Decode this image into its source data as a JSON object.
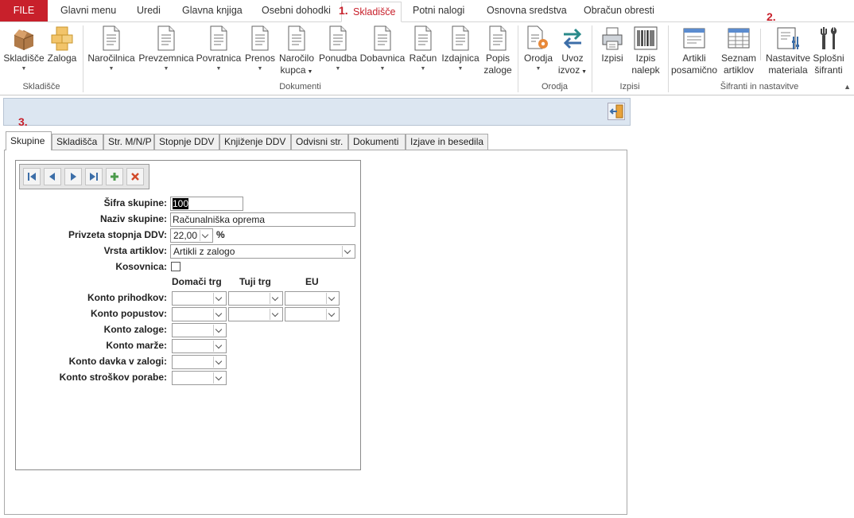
{
  "ribbon_tabs": [
    {
      "label": "FILE"
    },
    {
      "label": "Glavni menu"
    },
    {
      "label": "Uredi"
    },
    {
      "label": "Glavna knjiga"
    },
    {
      "label": "Osebni dohodki"
    },
    {
      "label": "Skladišče"
    },
    {
      "label": "Potni nalogi"
    },
    {
      "label": "Osnovna sredstva"
    },
    {
      "label": "Obračun obresti"
    }
  ],
  "markers": {
    "m1": "1.",
    "m2": "2.",
    "m3": "3."
  },
  "ribbon": {
    "buttons": [
      {
        "line1": "Skladišče",
        "line2": ""
      },
      {
        "line1": "Zaloga",
        "line2": ""
      },
      {
        "line1": "Naročilnica",
        "line2": ""
      },
      {
        "line1": "Prevzemnica",
        "line2": ""
      },
      {
        "line1": "Povratnica",
        "line2": ""
      },
      {
        "line1": "Prenos",
        "line2": ""
      },
      {
        "line1": "Naročilo",
        "line2": "kupca"
      },
      {
        "line1": "Ponudba",
        "line2": ""
      },
      {
        "line1": "Dobavnica",
        "line2": ""
      },
      {
        "line1": "Račun",
        "line2": ""
      },
      {
        "line1": "Izdajnica",
        "line2": ""
      },
      {
        "line1": "Popis",
        "line2": "zaloge"
      },
      {
        "line1": "Orodja",
        "line2": ""
      },
      {
        "line1": "Uvoz",
        "line2": "izvoz"
      },
      {
        "line1": "Izpisi",
        "line2": ""
      },
      {
        "line1": "Izpis",
        "line2": "nalepk"
      },
      {
        "line1": "Artikli",
        "line2": "posamično"
      },
      {
        "line1": "Seznam",
        "line2": "artiklov"
      },
      {
        "line1": "Nastavitve",
        "line2": "materiala"
      },
      {
        "line1": "Splošni",
        "line2": "šifranti"
      }
    ],
    "groups": [
      {
        "label": "Skladišče"
      },
      {
        "label": "Dokumenti"
      },
      {
        "label": "Orodja"
      },
      {
        "label": "Izpisi"
      },
      {
        "label": "Šifranti in nastavitve"
      }
    ]
  },
  "form_tabs": [
    {
      "label": "Skupine"
    },
    {
      "label": "Skladišča"
    },
    {
      "label": "Str. M/N/P"
    },
    {
      "label": "Stopnje DDV"
    },
    {
      "label": "Knjiženje DDV"
    },
    {
      "label": "Odvisni str."
    },
    {
      "label": "Dokumenti"
    },
    {
      "label": "Izjave in besedila"
    }
  ],
  "form": {
    "sifra_label": "Šifra skupine:",
    "sifra_value": "100",
    "naziv_label": "Naziv skupine:",
    "naziv_value": "Računalniška oprema",
    "ddv_label": "Privzeta stopnja DDV:",
    "ddv_value": "22,00",
    "ddv_unit": "%",
    "vrsta_label": "Vrsta artiklov:",
    "vrsta_value": "Artikli z zalogo",
    "kosovnica_label": "Kosovnica:",
    "kosovnica_checked": false,
    "col_domaci": "Domači trg",
    "col_tuji": "Tuji trg",
    "col_eu": "EU",
    "konto_labels": [
      "Konto prihodkov:",
      "Konto popustov:",
      "Konto zaloge:",
      "Konto marže:",
      "Konto davka v zalogi:",
      "Konto stroškov porabe:"
    ]
  }
}
